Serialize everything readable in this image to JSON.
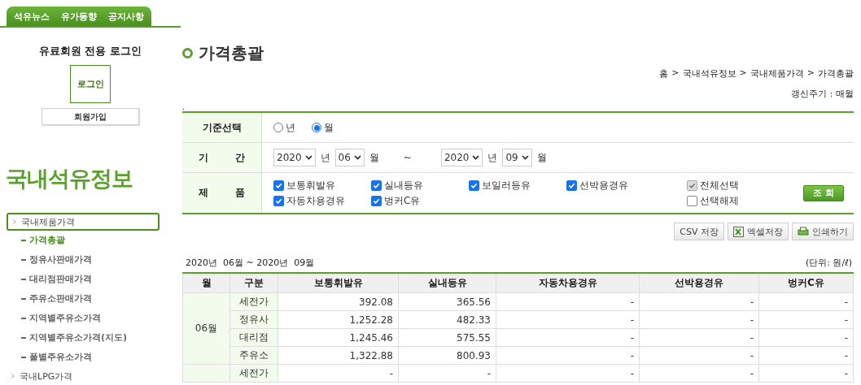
{
  "top_tabs": [
    {
      "label": "석유뉴스"
    },
    {
      "label": "유가동향"
    },
    {
      "label": "공지사항"
    }
  ],
  "login": {
    "title": "유료회원 전용 로그인",
    "login_button": "로그인",
    "join_button": "회원가입"
  },
  "section_title": "국내석유정보",
  "nav": [
    {
      "label": "국내제품가격",
      "expanded": true,
      "children": [
        {
          "label": "가격총괄",
          "selected": true
        },
        {
          "label": "정유사판매가격",
          "selected": false
        },
        {
          "label": "대리점판매가격",
          "selected": false
        },
        {
          "label": "주유소판매가격",
          "selected": false
        },
        {
          "label": "지역별주유소가격",
          "selected": false
        },
        {
          "label": "지역별주유소가격(지도)",
          "selected": false
        },
        {
          "label": "폴별주유소가격",
          "selected": false
        }
      ]
    },
    {
      "label": "국내LPG가격",
      "expanded": false
    }
  ],
  "page_title": "가격총괄",
  "breadcrumb": [
    "홈",
    "국내석유정보",
    "국내제품가격",
    "가격총괄"
  ],
  "breadcrumb_separator": ">",
  "update_cycle": "갱신주기 : 매월",
  "note": ".",
  "filter": {
    "basis": {
      "label": "기준선택",
      "options": [
        {
          "label": "년",
          "selected": false
        },
        {
          "label": "월",
          "selected": true
        }
      ]
    },
    "period": {
      "label": "기 간",
      "from_year": "2020",
      "from_month": "06",
      "to_year": "2020",
      "to_month": "09",
      "from_year_unit": "년",
      "from_month_unit": "월",
      "to_year_unit": "년",
      "to_month_unit": "월",
      "separator": "~"
    },
    "products": {
      "label": "제 품",
      "items": [
        {
          "label": "보통휘발유",
          "checked": true
        },
        {
          "label": "실내등유",
          "checked": true
        },
        {
          "label": "보일러등유",
          "checked": true
        },
        {
          "label": "선박용경유",
          "checked": true
        },
        {
          "label": "자동차용경유",
          "checked": true
        },
        {
          "label": "벙커C유",
          "checked": true
        }
      ],
      "select_all": {
        "label": "전체선택",
        "checked": true
      },
      "deselect_all": {
        "label": "선택해제",
        "checked": false
      }
    },
    "search_button": "조 회"
  },
  "export_buttons": [
    {
      "kind": "csv",
      "label": "CSV 저장"
    },
    {
      "kind": "excel",
      "label": "엑셀저장"
    },
    {
      "kind": "print",
      "label": "인쇄하기"
    }
  ],
  "range_text": "2020년  06월 ~ 2020년  09월",
  "unit_text": "(단위: 원/ℓ)",
  "table": {
    "columns": [
      "월",
      "구분",
      "보통휘발유",
      "실내등유",
      "자동차용경유",
      "선박용경유",
      "벙커C유"
    ],
    "groups": [
      {
        "month": "06월",
        "rows": [
          {
            "type": "세전가",
            "values": [
              "392.08",
              "365.56",
              "-",
              "-",
              "-"
            ]
          },
          {
            "type": "정유사",
            "values": [
              "1,252.28",
              "482.33",
              "-",
              "-",
              "-"
            ]
          },
          {
            "type": "대리점",
            "values": [
              "1,245.46",
              "575.55",
              "-",
              "-",
              "-"
            ]
          },
          {
            "type": "주유소",
            "values": [
              "1,322.88",
              "800.93",
              "-",
              "-",
              "-"
            ]
          }
        ]
      },
      {
        "rows": [
          {
            "type": "세전가",
            "values": [
              "-",
              "-",
              "-",
              "-",
              "-"
            ]
          }
        ]
      }
    ]
  }
}
